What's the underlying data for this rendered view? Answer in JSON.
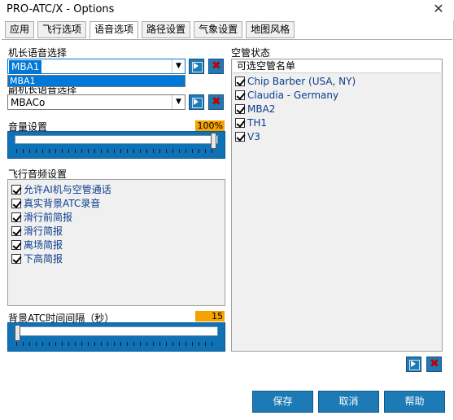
{
  "window": {
    "title": "PRO-ATC/X - Options",
    "close_glyph": "✕"
  },
  "tabs": [
    {
      "label": "应用"
    },
    {
      "label": "飞行选项"
    },
    {
      "label": "语音选项",
      "active": true
    },
    {
      "label": "路径设置"
    },
    {
      "label": "气象设置"
    },
    {
      "label": "地图风格"
    }
  ],
  "captain_voice": {
    "label": "机长语音选择",
    "value": "MBA1",
    "dropdown_item": "MBA1"
  },
  "copilot_voice": {
    "label": "副机长语音选择",
    "value": "MBACo"
  },
  "volume": {
    "label": "音量设置",
    "value": "100%",
    "level": 1.0
  },
  "flight_audio": {
    "label": "飞行音频设置",
    "items": [
      {
        "label": "允许AI机与空管通话",
        "checked": true
      },
      {
        "label": "真实背景ATC录音",
        "checked": true
      },
      {
        "label": "滑行前简报",
        "checked": true
      },
      {
        "label": "滑行简报",
        "checked": true
      },
      {
        "label": "离场简报",
        "checked": true
      },
      {
        "label": "下高简报",
        "checked": true
      }
    ]
  },
  "atc_interval": {
    "label": "背景ATC时间间隔（秒）",
    "value": "15",
    "level": 0.0
  },
  "atc_status": {
    "label": "空管状态",
    "header": "可选空管名单",
    "items": [
      {
        "label": "Chip Barber (USA, NY)",
        "checked": true
      },
      {
        "label": "Claudia - Germany",
        "checked": true
      },
      {
        "label": "MBA2",
        "checked": true
      },
      {
        "label": "TH1",
        "checked": true
      },
      {
        "label": "V3",
        "checked": true
      }
    ]
  },
  "buttons": {
    "save": "保存",
    "cancel": "取消",
    "help": "帮助"
  },
  "colors": {
    "accent": "#1d7ab5",
    "highlight": "#0078d7",
    "badge": "#f5a300",
    "delete": "#c00000"
  },
  "icons": {
    "play": "play-icon",
    "delete": "delete-icon",
    "dropdown": "chevron-down-icon"
  }
}
